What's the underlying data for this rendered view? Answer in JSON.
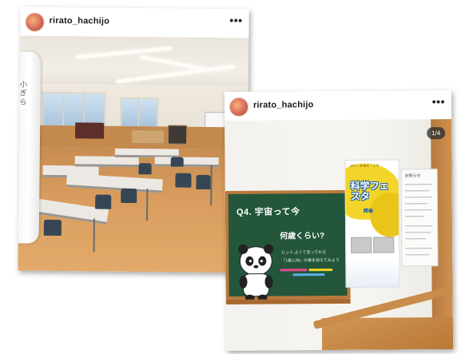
{
  "posts": [
    {
      "username": "rirato_hachijo",
      "more_label": "•••",
      "photo_label": "classroom-photo",
      "banner_text": "小 ぎ ら"
    },
    {
      "username": "rirato_hachijo",
      "more_label": "•••",
      "counter": "1/4",
      "board": {
        "question": "Q4. 宇宙って今",
        "question2": "何歳くらい?",
        "hint1": "ヒント:よくて言ってれる",
        "hint2": "「1星に向」の後を抑えてみよう"
      },
      "poster_fes": {
        "top": "ぴっ・かなえ・ころ",
        "title": "科学フェスタ",
        "subtitle": "開催"
      },
      "poster_w": {
        "header": "お知らせ"
      }
    }
  ],
  "colors": {
    "board": "#23563b",
    "wood": "#b97a3c",
    "poster_yellow": "#f3d52a",
    "poster_blue": "#1a5fa8"
  }
}
